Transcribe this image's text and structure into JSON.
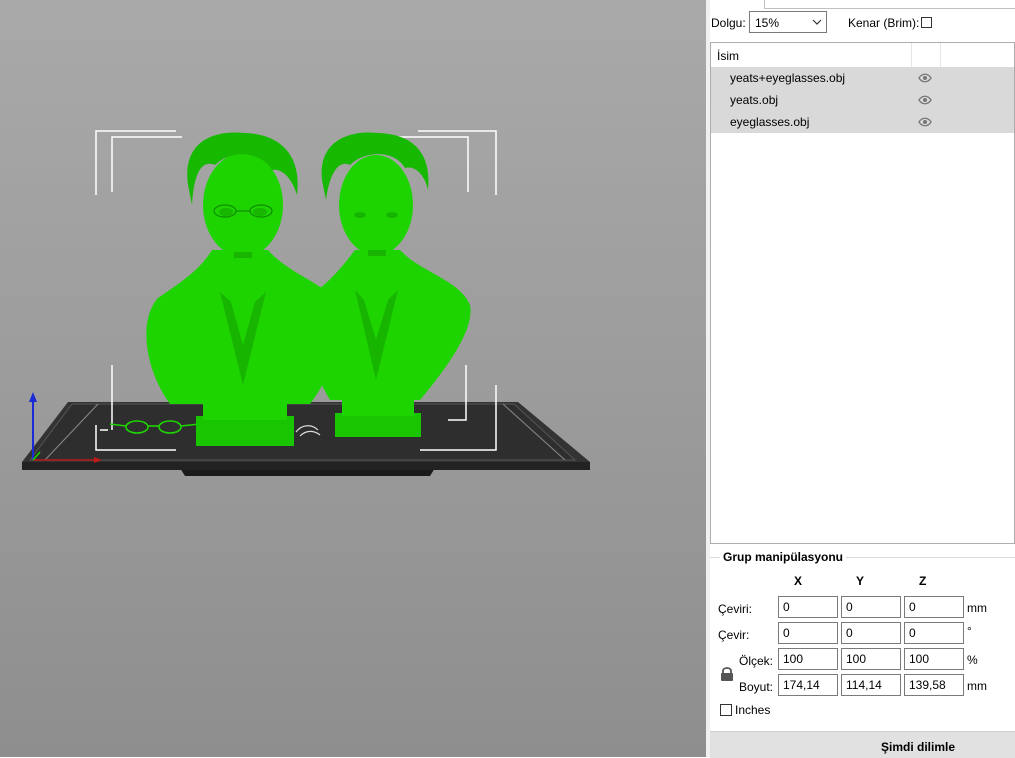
{
  "settings": {
    "infill_label": "Dolgu:",
    "infill_value": "15%",
    "brim_label": "Kenar (Brim):"
  },
  "object_list": {
    "header": "İsim",
    "items": [
      {
        "name": "yeats+eyeglasses.obj",
        "icon": "eye-icon"
      },
      {
        "name": "yeats.obj",
        "icon": "eye-icon"
      },
      {
        "name": "eyeglasses.obj",
        "icon": "eye-icon"
      }
    ]
  },
  "group_manipulation": {
    "title": "Grup manipülasyonu",
    "axes": [
      "X",
      "Y",
      "Z"
    ],
    "rows": [
      {
        "label": "Çeviri:",
        "values": [
          "0",
          "0",
          "0"
        ],
        "unit": "mm"
      },
      {
        "label": "Çevir:",
        "values": [
          "0",
          "0",
          "0"
        ],
        "unit": "°"
      },
      {
        "label": "Ölçek:",
        "values": [
          "100",
          "100",
          "100"
        ],
        "unit": "%"
      },
      {
        "label": "Boyut:",
        "values": [
          "174,14",
          "114,14",
          "139,58"
        ],
        "unit": "mm"
      }
    ],
    "inches_label": "Inches"
  },
  "slice_button": "Şimdi dilimle",
  "colors": {
    "model_green": "#1dd400",
    "bed": "#2b2b2b",
    "selected_row": "#d9d9d9"
  }
}
